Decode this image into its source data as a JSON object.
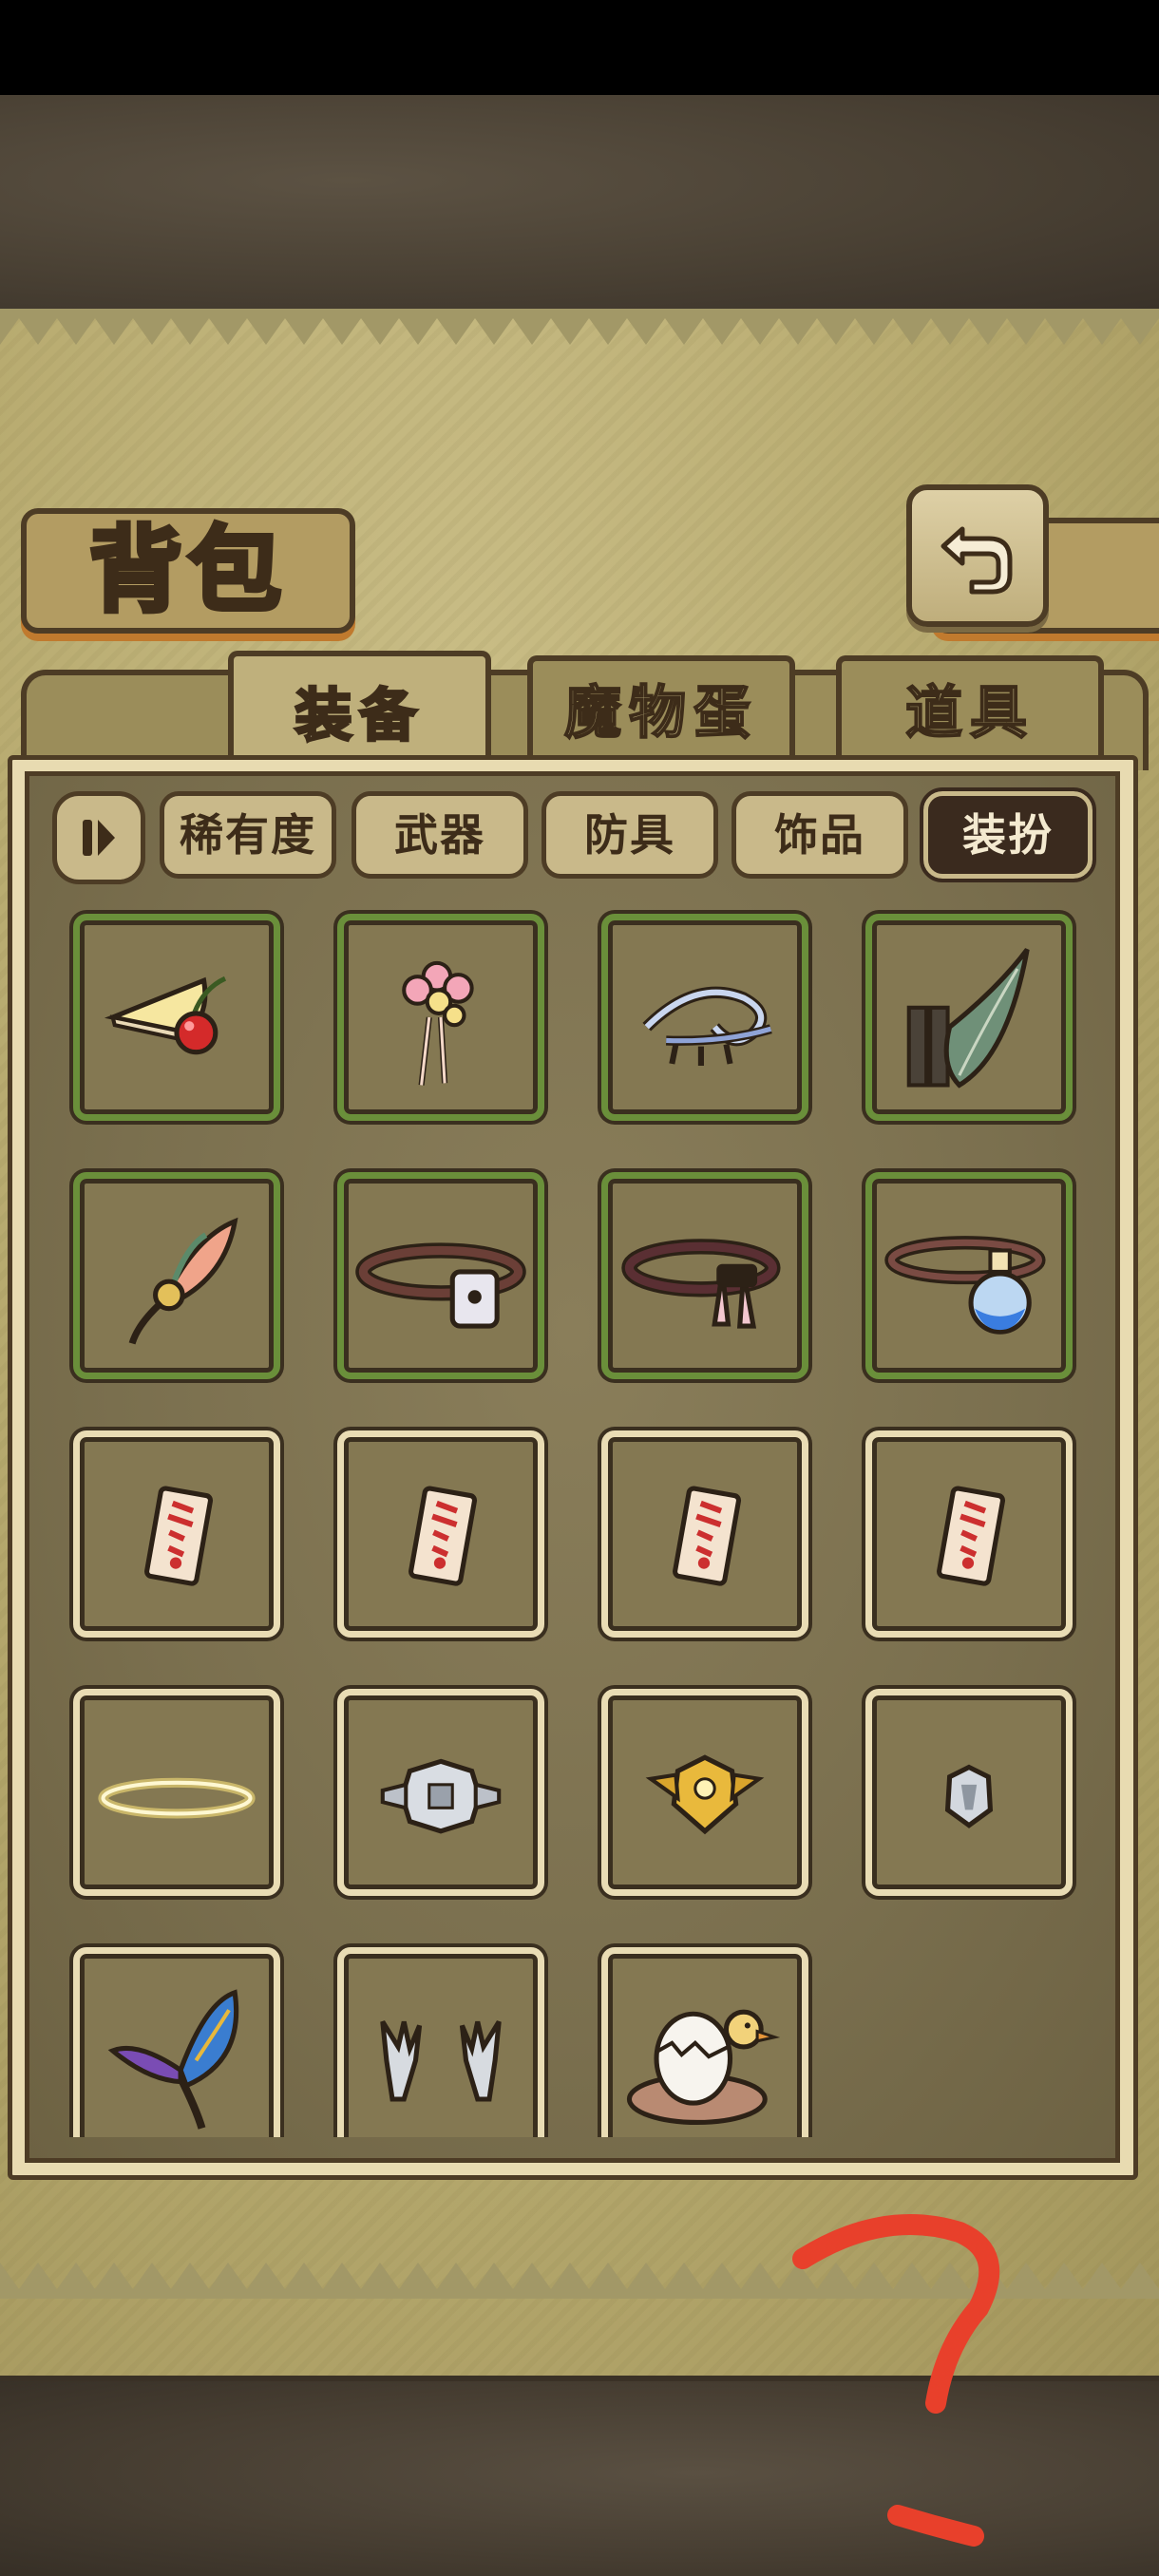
{
  "screen": {
    "title": "背包",
    "tabs": [
      {
        "label": "装备",
        "active": true
      },
      {
        "label": "魔物蛋",
        "active": false
      },
      {
        "label": "道具",
        "active": false
      }
    ],
    "filters": [
      {
        "label": "稀有度",
        "active": false
      },
      {
        "label": "武器",
        "active": false
      },
      {
        "label": "防具",
        "active": false
      },
      {
        "label": "饰品",
        "active": false
      },
      {
        "label": "装扮",
        "active": true
      }
    ],
    "items": [
      {
        "icon": "cake-slice-cherry-icon",
        "frame": "green"
      },
      {
        "icon": "flower-hairpin-icon",
        "frame": "green"
      },
      {
        "icon": "wind-ribbon-icon",
        "frame": "green"
      },
      {
        "icon": "feather-wing-icon",
        "frame": "green"
      },
      {
        "icon": "leaf-brooch-icon",
        "frame": "green"
      },
      {
        "icon": "lock-collar-icon",
        "frame": "green"
      },
      {
        "icon": "bunny-collar-icon",
        "frame": "green"
      },
      {
        "icon": "potion-collar-icon",
        "frame": "green"
      },
      {
        "icon": "talisman-card-icon",
        "frame": "plain"
      },
      {
        "icon": "talisman-card-icon",
        "frame": "plain"
      },
      {
        "icon": "talisman-card-icon",
        "frame": "plain"
      },
      {
        "icon": "talisman-card-icon",
        "frame": "plain"
      },
      {
        "icon": "halo-icon",
        "frame": "plain"
      },
      {
        "icon": "silver-crest-icon",
        "frame": "plain"
      },
      {
        "icon": "gold-crest-icon",
        "frame": "plain"
      },
      {
        "icon": "small-crest-icon",
        "frame": "plain"
      },
      {
        "icon": "butterfly-wing-icon",
        "frame": "plain"
      },
      {
        "icon": "claw-gloves-icon",
        "frame": "plain"
      },
      {
        "icon": "egg-nest-duck-icon",
        "frame": "plain"
      }
    ]
  },
  "colors": {
    "frame_green": "#6a8f3a",
    "frame_plain": "#e9dcb4",
    "outline": "#3a2f1f",
    "scribble": "#e8402b"
  }
}
